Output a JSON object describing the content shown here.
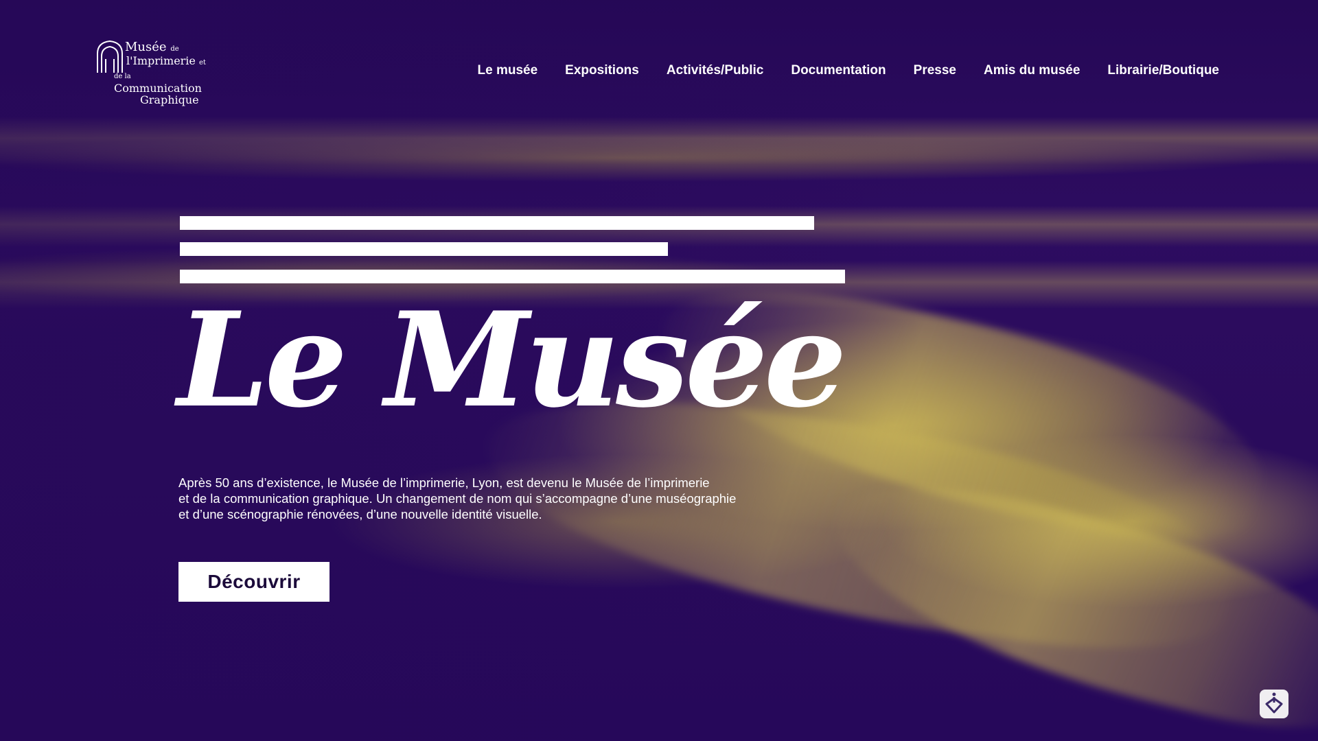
{
  "brand": {
    "logo_line1": "Musée",
    "logo_line1_small": "de",
    "logo_line2": "l'Imprimerie",
    "logo_line2_small": "et",
    "logo_line3_small": "de la",
    "logo_line3": "Communication",
    "logo_line4": "Graphique"
  },
  "nav": {
    "items": [
      {
        "label": "Le musée"
      },
      {
        "label": "Expositions"
      },
      {
        "label": "Activités/Public"
      },
      {
        "label": "Documentation"
      },
      {
        "label": "Presse"
      },
      {
        "label": "Amis du musée"
      },
      {
        "label": "Librairie/Boutique"
      }
    ]
  },
  "hero": {
    "title": "Le Musée",
    "text_lines": [
      "Après 50 ans d’existence, le Musée de l’imprimerie, Lyon, est devenu le Musée de l’imprimerie",
      "et de la communication graphique. Un changement de nom qui s’accompagne d’une muséographie",
      "et d’une scénographie rénovées, d’une nouvelle identité visuelle."
    ],
    "cta_label": "Découvrir"
  },
  "colors": {
    "background": "#2a0b5e",
    "accent_yellow": "#c9b455",
    "text": "#ffffff",
    "button_text": "#1b0a3a"
  },
  "icons": {
    "logo": "arch-logo-icon",
    "accessibility": "accessibility-icon"
  }
}
